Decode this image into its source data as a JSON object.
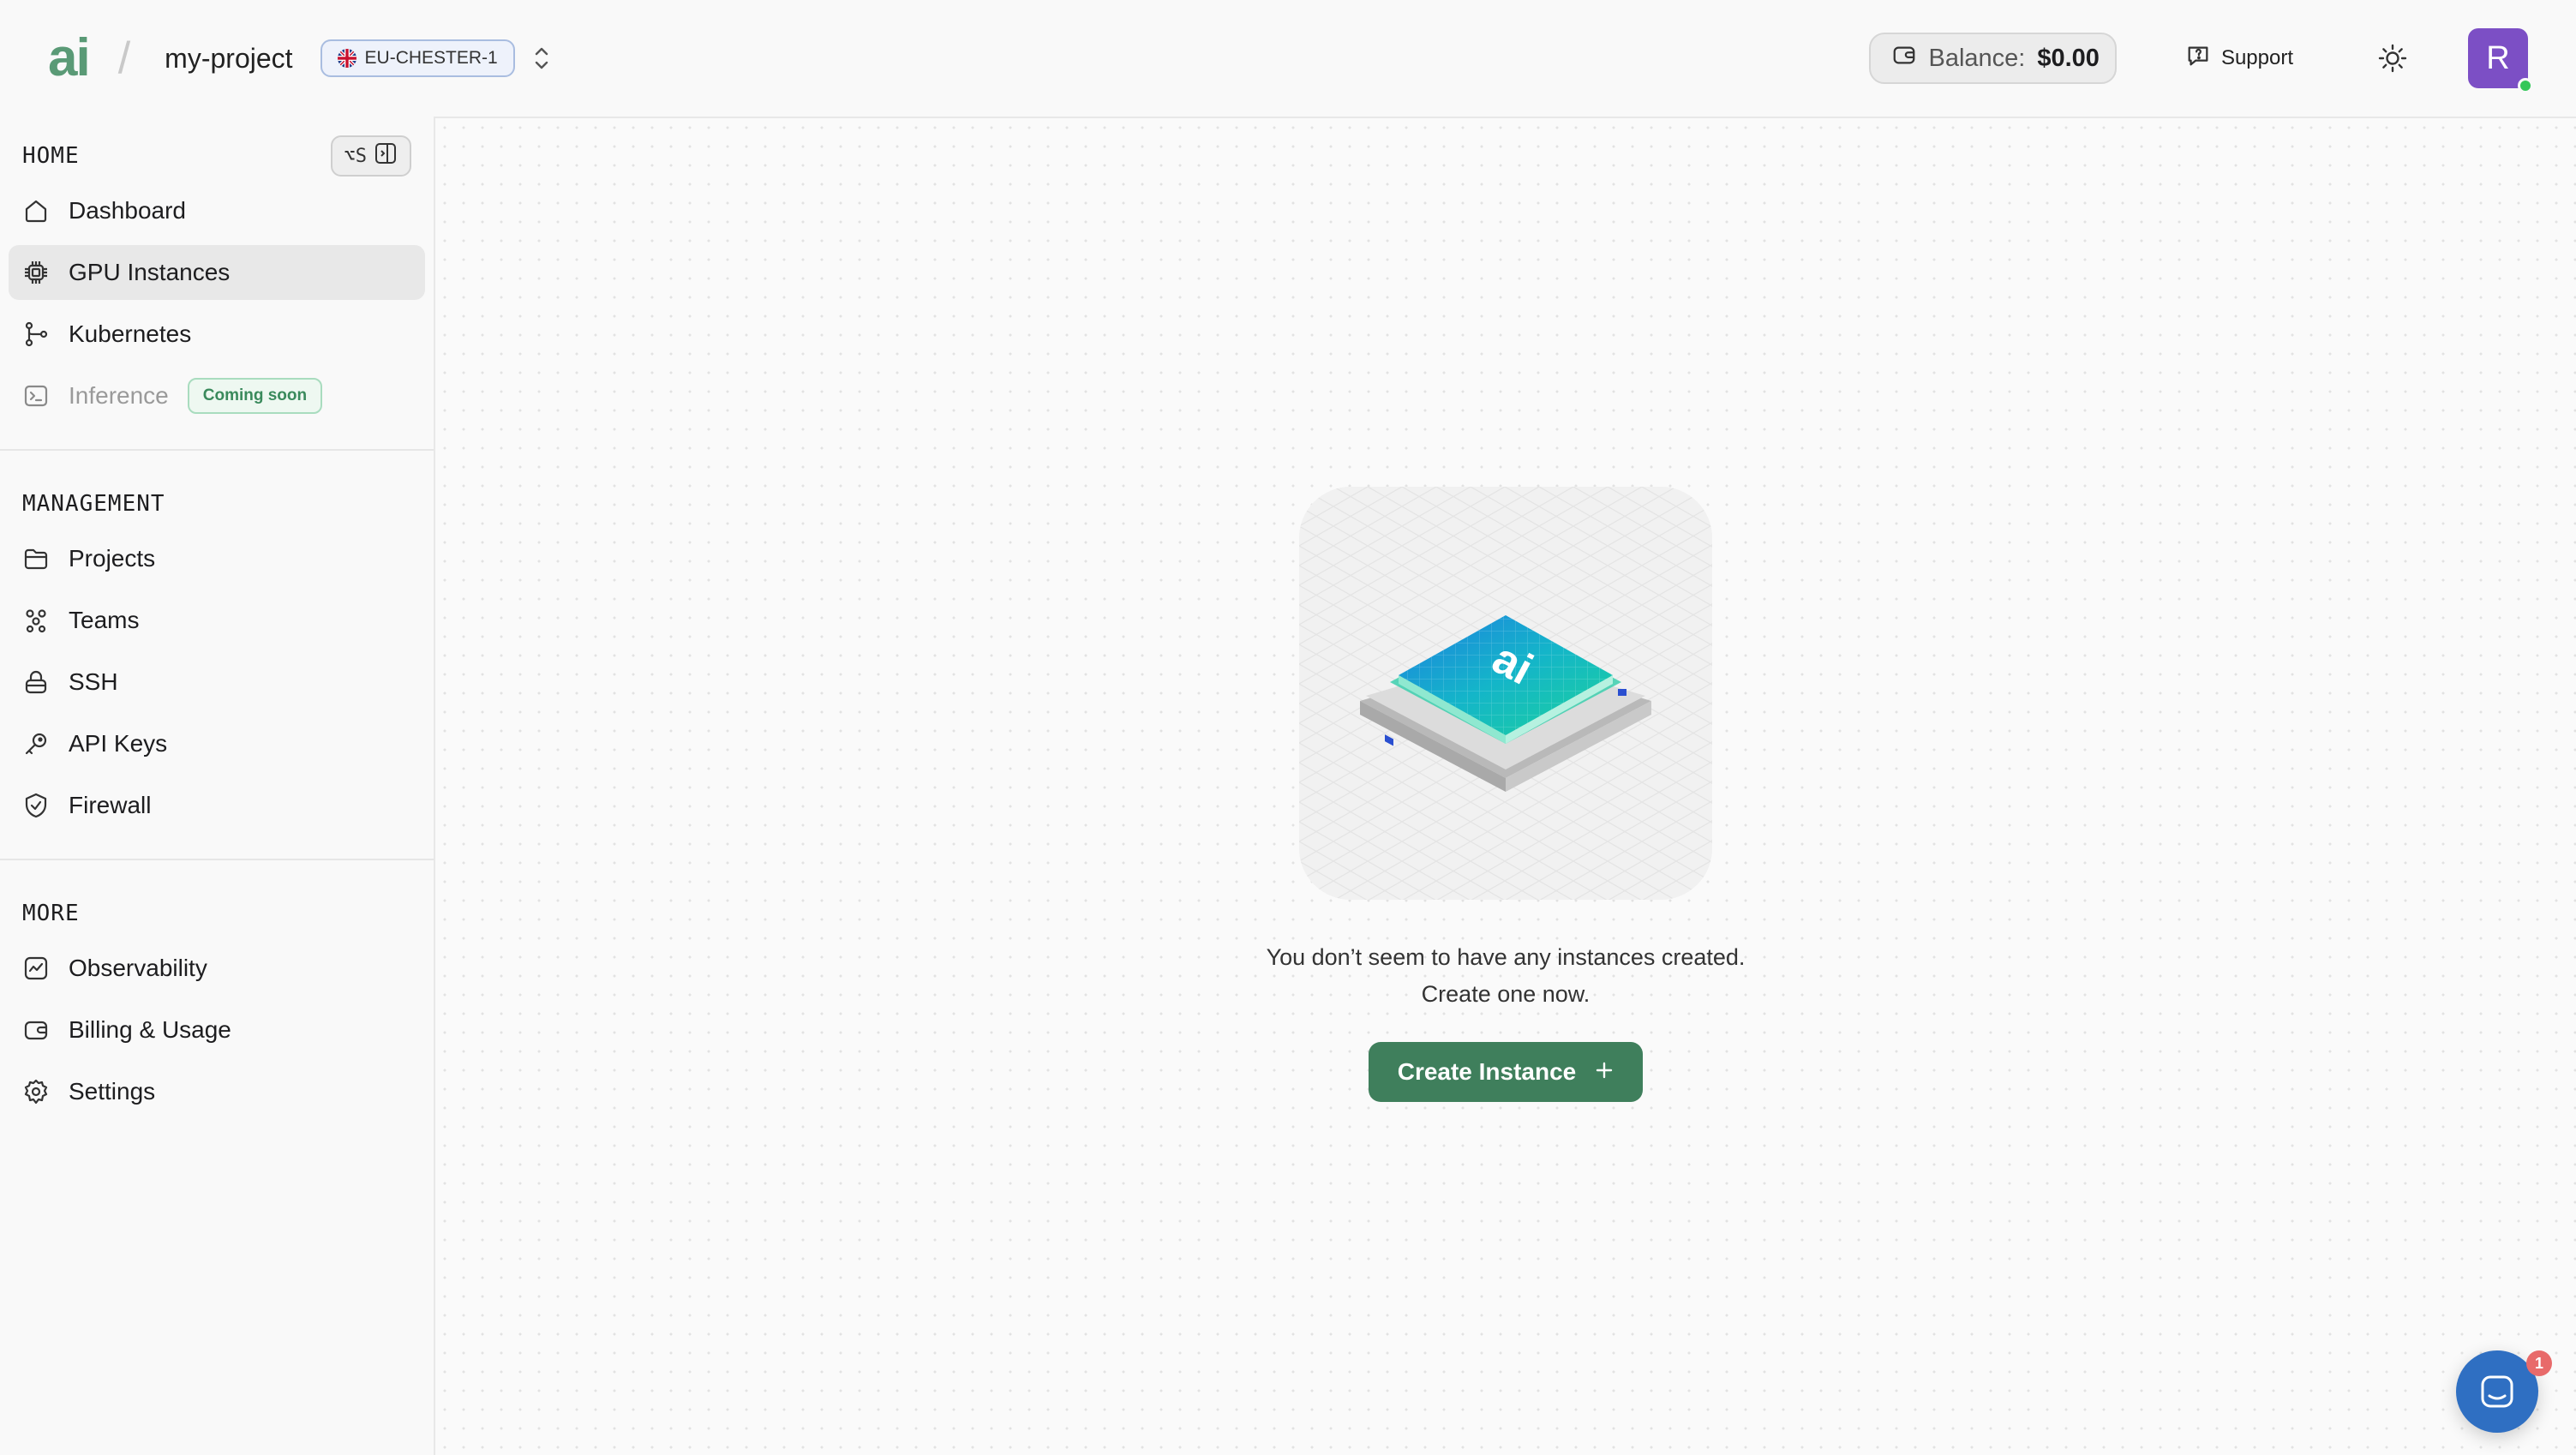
{
  "header": {
    "logo_text": "ai",
    "separator": "/",
    "project_name": "my-project",
    "region": "EU-CHESTER-1",
    "balance_label": "Balance:",
    "balance_value": "$0.00",
    "support_label": "Support",
    "avatar_initial": "R"
  },
  "sidebar": {
    "home": {
      "title": "HOME",
      "shortcut": "⌥S",
      "items": [
        {
          "label": "Dashboard",
          "icon": "home-icon"
        },
        {
          "label": "GPU Instances",
          "icon": "chip-icon",
          "active": true
        },
        {
          "label": "Kubernetes",
          "icon": "kubernetes-icon"
        },
        {
          "label": "Inference",
          "icon": "terminal-icon",
          "disabled": true,
          "badge": "Coming soon"
        }
      ]
    },
    "management": {
      "title": "MANAGEMENT",
      "items": [
        {
          "label": "Projects",
          "icon": "folder-icon"
        },
        {
          "label": "Teams",
          "icon": "teams-icon"
        },
        {
          "label": "SSH",
          "icon": "lock-icon"
        },
        {
          "label": "API Keys",
          "icon": "key-icon"
        },
        {
          "label": "Firewall",
          "icon": "shield-icon"
        }
      ]
    },
    "more": {
      "title": "MORE",
      "items": [
        {
          "label": "Observability",
          "icon": "chart-icon"
        },
        {
          "label": "Billing & Usage",
          "icon": "wallet-icon"
        },
        {
          "label": "Settings",
          "icon": "gear-icon"
        }
      ]
    }
  },
  "main": {
    "empty_line1": "You don’t seem to have any instances created.",
    "empty_line2": "Create one now.",
    "create_button": "Create Instance"
  },
  "chat": {
    "badge_count": "1"
  },
  "colors": {
    "brand_green": "#5a9a76",
    "button_green": "#3f7f5c",
    "avatar_purple": "#7c4fc5",
    "chat_blue": "#2f6fc2"
  }
}
